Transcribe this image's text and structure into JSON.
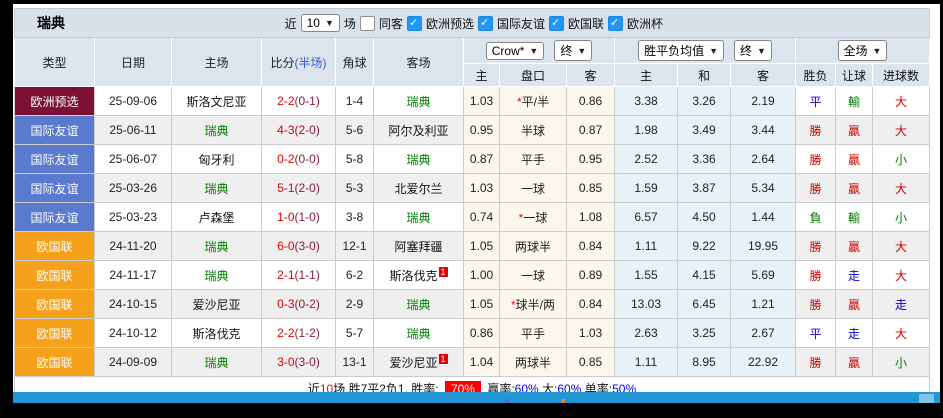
{
  "title": "瑞典",
  "topbar": {
    "near_label": "近",
    "matches_value": "10",
    "matches_unit": "场",
    "same_away_label": "同客",
    "filters": [
      {
        "label": "欧洲预选",
        "checked": true
      },
      {
        "label": "国际友谊",
        "checked": true
      },
      {
        "label": "欧国联",
        "checked": true
      },
      {
        "label": "欧洲杯",
        "checked": true
      }
    ]
  },
  "dropdowns": {
    "odds_company": "Crow*",
    "odds_state": "终",
    "avg_type": "胜平负均值",
    "avg_state": "终",
    "scope": "全场"
  },
  "columns": {
    "type": "类型",
    "date": "日期",
    "home": "主场",
    "score": "比分",
    "score_half": "(半场)",
    "corner": "角球",
    "away": "客场",
    "odds_home": "主",
    "handicap": "盘口",
    "odds_away": "客",
    "avg_home": "主",
    "avg_draw": "和",
    "avg_away": "客",
    "result": "胜负",
    "handicap_result": "让球",
    "goals": "进球数"
  },
  "rows": [
    {
      "type": "欧洲预选",
      "date": "25-09-06",
      "home": "斯洛文尼亚",
      "score_ft": "2-2",
      "score_ht": "(0-1)",
      "corner": "1-4",
      "away": "瑞典",
      "odds_home": "1.03",
      "hc_star": "*",
      "handicap": "平/半",
      "odds_away": "0.86",
      "avg_home": "3.38",
      "avg_draw": "3.26",
      "avg_away": "2.19",
      "result": "平",
      "hc_result": "輸",
      "goals": "大"
    },
    {
      "type": "国际友谊",
      "date": "25-06-11",
      "home": "瑞典",
      "score_ft": "4-3",
      "score_ht": "(2-0)",
      "corner": "5-6",
      "away": "阿尔及利亚",
      "odds_home": "0.95",
      "hc_star": "",
      "handicap": "半球",
      "odds_away": "0.87",
      "avg_home": "1.98",
      "avg_draw": "3.49",
      "avg_away": "3.44",
      "result": "勝",
      "hc_result": "贏",
      "goals": "大"
    },
    {
      "type": "国际友谊",
      "date": "25-06-07",
      "home": "匈牙利",
      "score_ft": "0-2",
      "score_ht": "(0-0)",
      "corner": "5-8",
      "away": "瑞典",
      "odds_home": "0.87",
      "hc_star": "",
      "handicap": "平手",
      "odds_away": "0.95",
      "avg_home": "2.52",
      "avg_draw": "3.36",
      "avg_away": "2.64",
      "result": "勝",
      "hc_result": "贏",
      "goals": "小"
    },
    {
      "type": "国际友谊",
      "date": "25-03-26",
      "home": "瑞典",
      "score_ft": "5-1",
      "score_ht": "(2-0)",
      "corner": "5-3",
      "away": "北爱尔兰",
      "odds_home": "1.03",
      "hc_star": "",
      "handicap": "一球",
      "odds_away": "0.85",
      "avg_home": "1.59",
      "avg_draw": "3.87",
      "avg_away": "5.34",
      "result": "勝",
      "hc_result": "贏",
      "goals": "大"
    },
    {
      "type": "国际友谊",
      "date": "25-03-23",
      "home": "卢森堡",
      "score_ft": "1-0",
      "score_ht": "(1-0)",
      "corner": "3-8",
      "away": "瑞典",
      "odds_home": "0.74",
      "hc_star": "*",
      "handicap": "一球",
      "odds_away": "1.08",
      "avg_home": "6.57",
      "avg_draw": "4.50",
      "avg_away": "1.44",
      "result": "負",
      "hc_result": "輸",
      "goals": "小"
    },
    {
      "type": "欧国联",
      "date": "24-11-20",
      "home": "瑞典",
      "score_ft": "6-0",
      "score_ht": "(3-0)",
      "corner": "12-1",
      "away": "阿塞拜疆",
      "odds_home": "1.05",
      "hc_star": "",
      "handicap": "两球半",
      "odds_away": "0.84",
      "avg_home": "1.11",
      "avg_draw": "9.22",
      "avg_away": "19.95",
      "result": "勝",
      "hc_result": "贏",
      "goals": "大"
    },
    {
      "type": "欧国联",
      "date": "24-11-17",
      "home": "瑞典",
      "score_ft": "2-1",
      "score_ht": "(1-1)",
      "corner": "6-2",
      "away": "斯洛伐克",
      "away_note": "1",
      "odds_home": "1.00",
      "hc_star": "",
      "handicap": "一球",
      "odds_away": "0.89",
      "avg_home": "1.55",
      "avg_draw": "4.15",
      "avg_away": "5.69",
      "result": "勝",
      "hc_result": "走",
      "goals": "大"
    },
    {
      "type": "欧国联",
      "date": "24-10-15",
      "home": "爱沙尼亚",
      "score_ft": "0-3",
      "score_ht": "(0-2)",
      "corner": "2-9",
      "away": "瑞典",
      "odds_home": "1.05",
      "hc_star": "*",
      "handicap": "球半/两",
      "odds_away": "0.84",
      "avg_home": "13.03",
      "avg_draw": "6.45",
      "avg_away": "1.21",
      "result": "勝",
      "hc_result": "贏",
      "goals": "走"
    },
    {
      "type": "欧国联",
      "date": "24-10-12",
      "home": "斯洛伐克",
      "score_ft": "2-2",
      "score_ht": "(1-2)",
      "corner": "5-7",
      "away": "瑞典",
      "odds_home": "0.86",
      "hc_star": "",
      "handicap": "平手",
      "odds_away": "1.03",
      "avg_home": "2.63",
      "avg_draw": "3.25",
      "avg_away": "2.67",
      "result": "平",
      "hc_result": "走",
      "goals": "大"
    },
    {
      "type": "欧国联",
      "date": "24-09-09",
      "home": "瑞典",
      "score_ft": "3-0",
      "score_ht": "(3-0)",
      "corner": "13-1",
      "away": "爱沙尼亚",
      "away_note": "1",
      "odds_home": "1.04",
      "hc_star": "",
      "handicap": "两球半",
      "odds_away": "0.85",
      "avg_home": "1.11",
      "avg_draw": "8.95",
      "avg_away": "22.92",
      "result": "勝",
      "hc_result": "贏",
      "goals": "小"
    }
  ],
  "footer": {
    "seg1": "近",
    "seg1_num": "10",
    "seg2": "场,胜7平2负1, 胜率:",
    "win_rate": "70%",
    "seg3": "赢率:",
    "seg3_val": "60%",
    "seg4": "大:",
    "seg4_val": "60%",
    "seg5": "单率:",
    "seg5_val": "50%"
  },
  "colors": {
    "badge_euro_qualifier": "#7b1134",
    "badge_friendly": "#5a7ace",
    "badge_nations_league": "#f6a11c",
    "win_red": "#d40000",
    "lose_green": "#007a00",
    "draw_blue": "#0000d8",
    "team_highlight_green": "#008000",
    "score_fulltime_red": "#e10000",
    "score_halftime_maroon": "#8f1a3c",
    "rate_highlight_bg": "#ff0000",
    "checkbox_blue": "#2196f3",
    "bottom_bar_blue": "#2297d4",
    "header_bg": "#dce4ee"
  }
}
